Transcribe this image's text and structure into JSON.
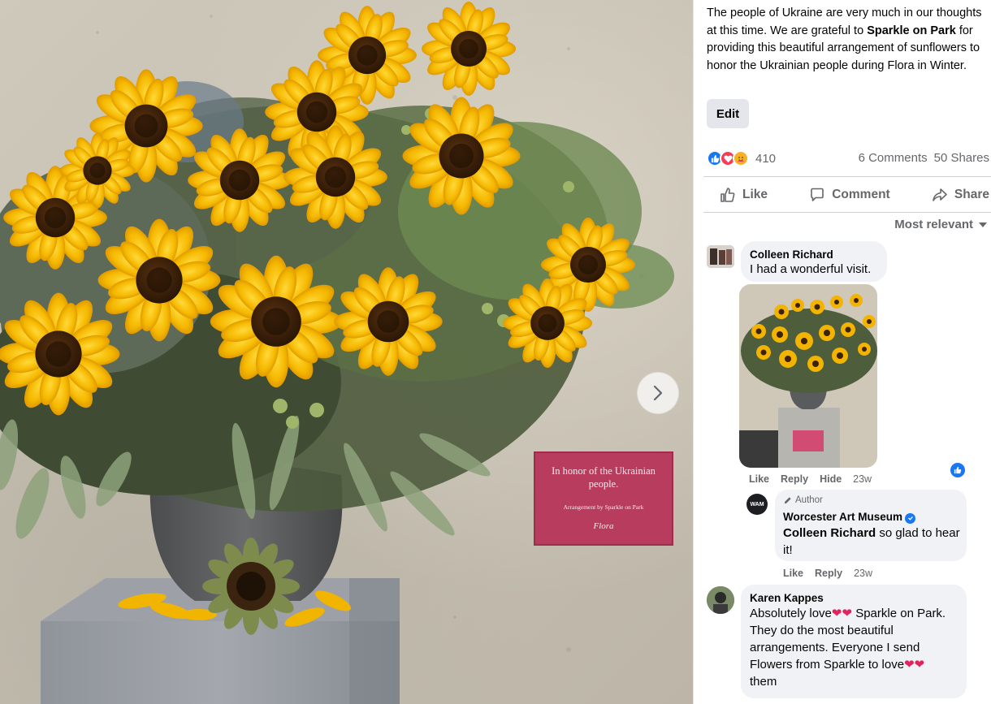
{
  "photo": {
    "sign_line1": "In honor of the Ukrainian people.",
    "sign_line2": "Arrangement by Sparkle on Park",
    "sign_logo": "Flora",
    "next_icon": "chevron-right-icon"
  },
  "post": {
    "caption_part1": "The people of Ukraine are very much in our thoughts at this time. We are grateful to ",
    "caption_bold": "Sparkle on Park",
    "caption_part2": " for providing this beautiful arrangement of sunflowers to honor the Ukrainian people during Flora in Winter.",
    "edit_label": "Edit",
    "reaction_icons": [
      "like-icon",
      "love-icon",
      "care-icon"
    ],
    "reaction_count": "410",
    "comments_count": "6 Comments",
    "shares_count": "50 Shares"
  },
  "actions": {
    "like": "Like",
    "comment": "Comment",
    "share": "Share"
  },
  "sort_label": "Most relevant",
  "comments": [
    {
      "name": "Colleen Richard",
      "text": "I had a wonderful visit.",
      "like": "Like",
      "reply": "Reply",
      "hide": "Hide",
      "time": "23w"
    },
    {
      "badge": "Author",
      "avatar_text": "WAM",
      "name": "Worcester Art Museum",
      "mention": "Colleen Richard",
      "text": " so glad to hear it!",
      "like": "Like",
      "reply": "Reply",
      "time": "23w"
    },
    {
      "name": "Karen Kappes",
      "text_a": "Absolutely love",
      "text_b": " Sparkle on Park. They do the most beautiful arrangements. Everyone I send Flowers from Sparkle to love",
      "text_c": " them"
    }
  ],
  "colors": {
    "facebook_blue": "#1877f2",
    "sign_red": "#b73c5e",
    "secondary_text": "#65676b",
    "bubble_bg": "#f0f2f5"
  }
}
